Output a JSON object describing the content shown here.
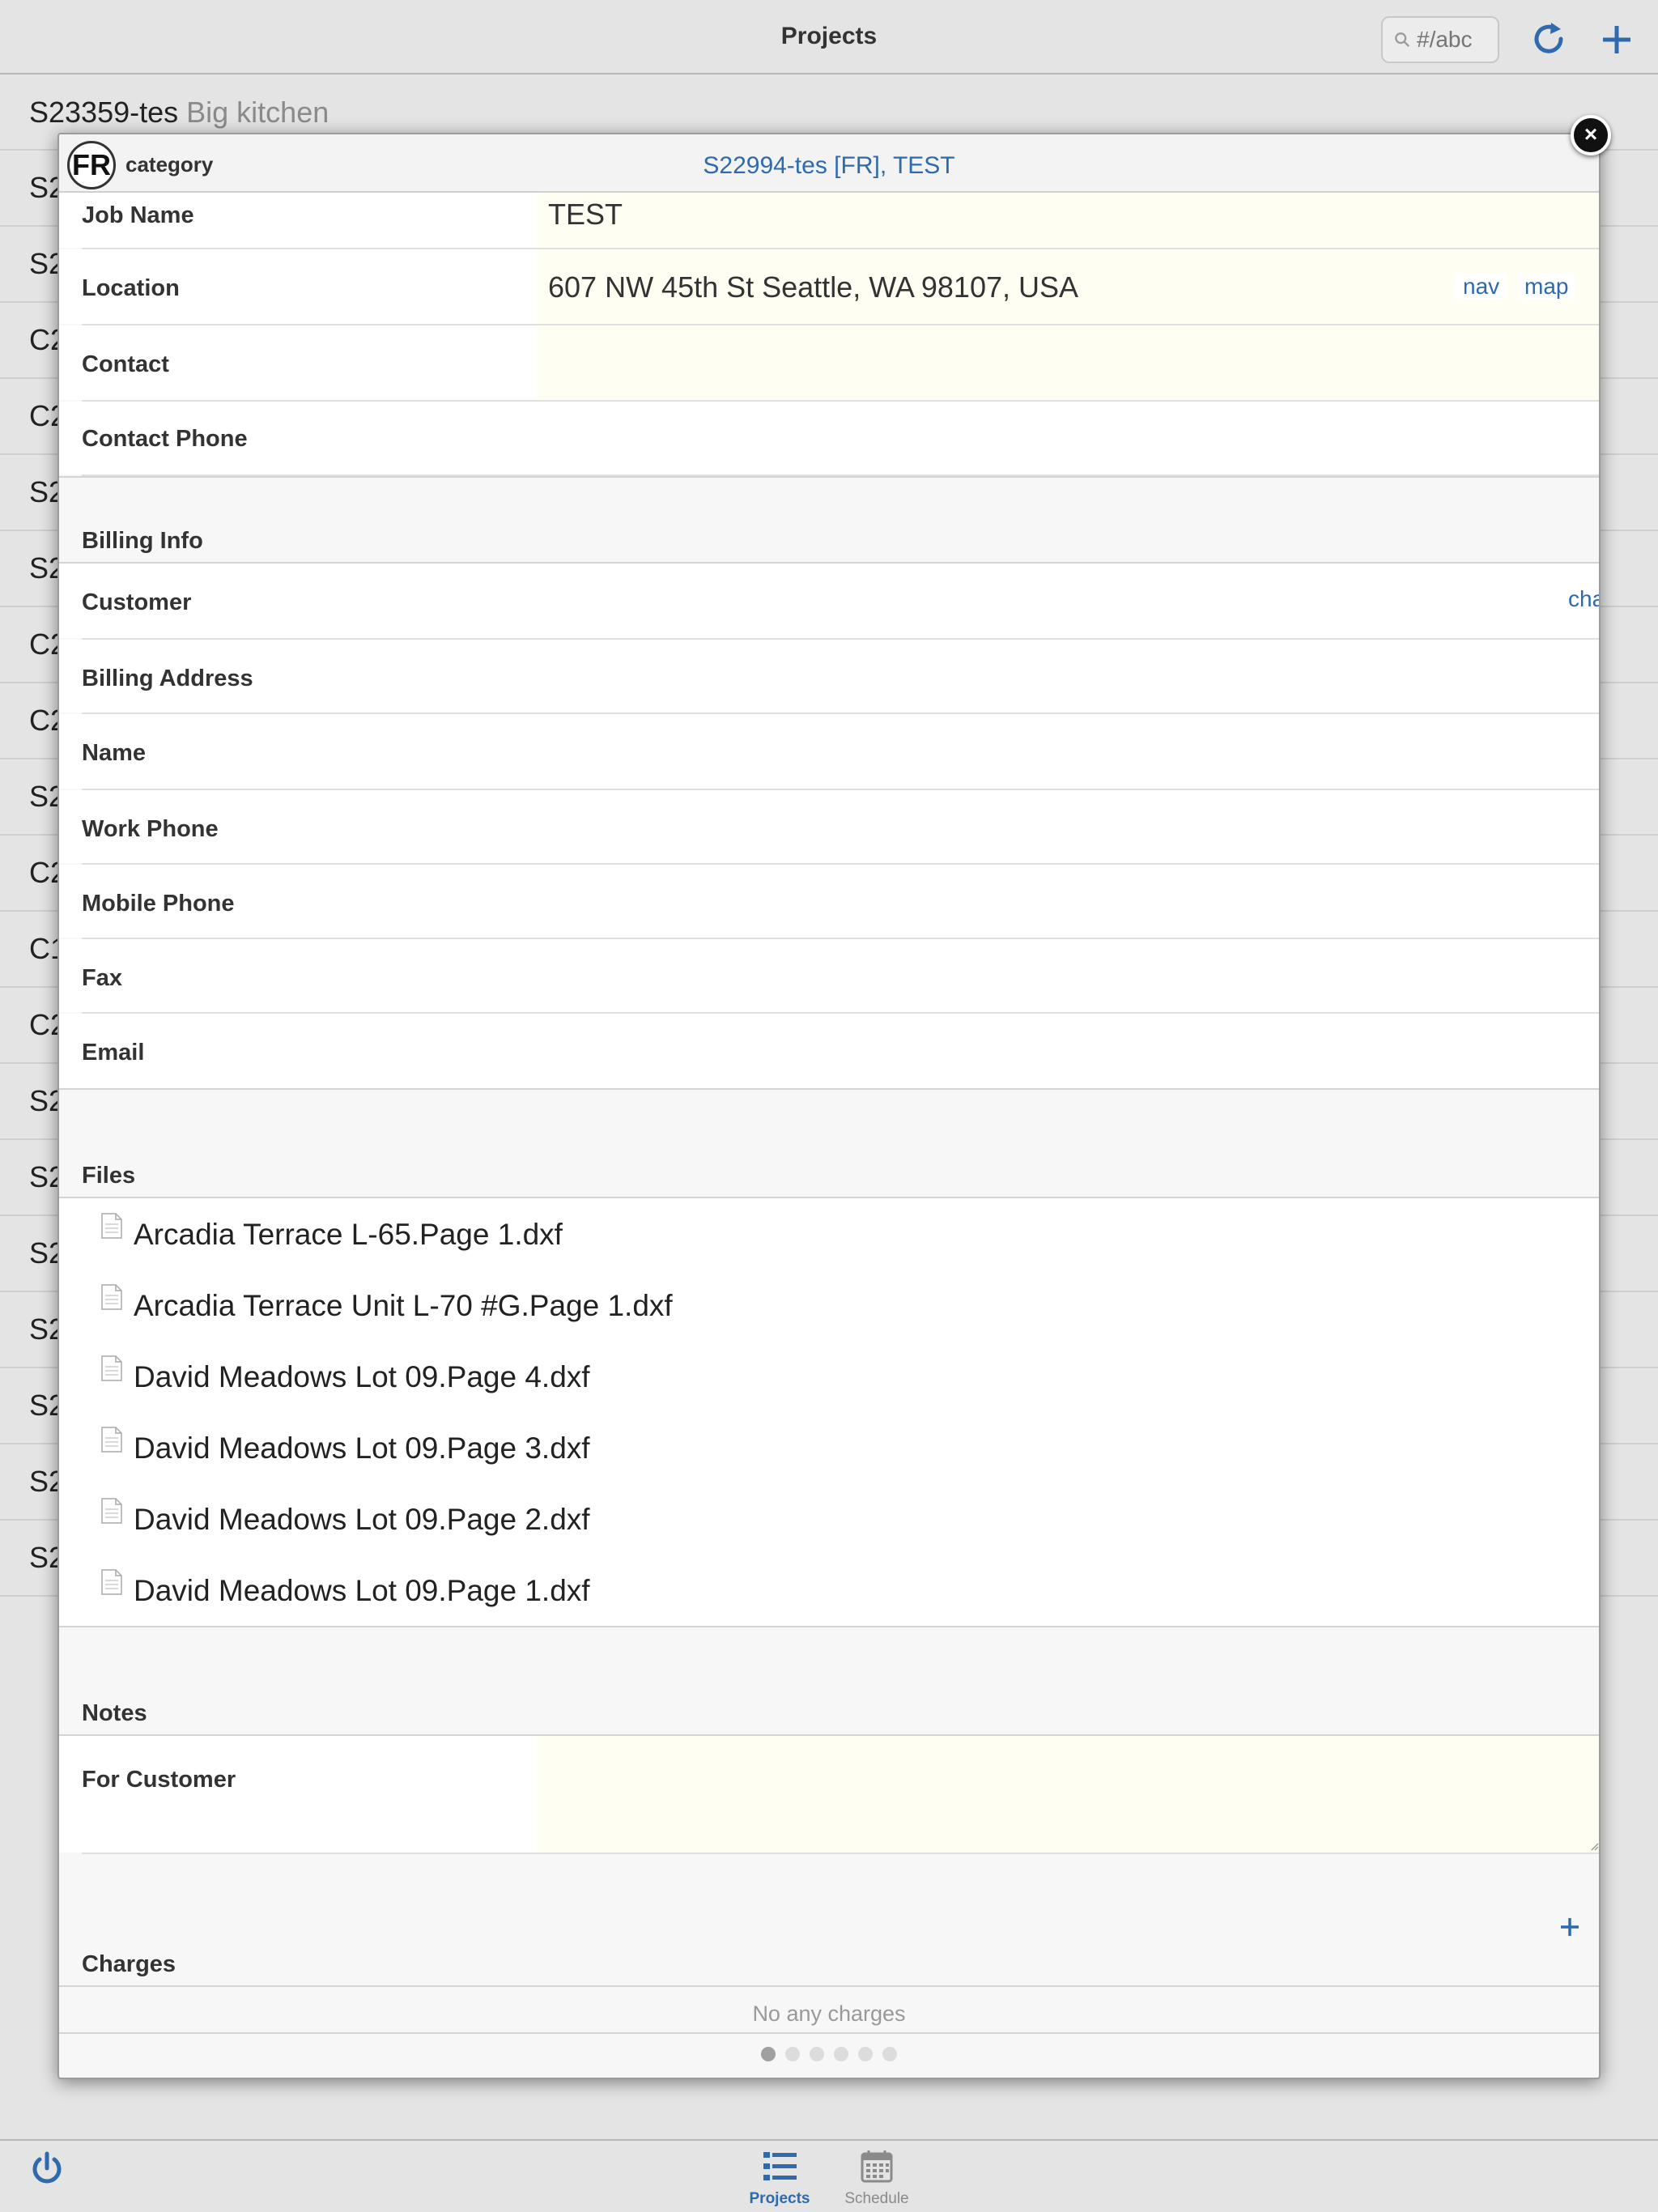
{
  "topbar": {
    "title": "Projects",
    "search_placeholder": "#/abc"
  },
  "background_list": [
    {
      "code": "S23359-tes",
      "desc": "Big kitchen"
    },
    {
      "code": "S2",
      "desc": ""
    },
    {
      "code": "S2",
      "desc": ""
    },
    {
      "code": "C2",
      "desc": ""
    },
    {
      "code": "C2",
      "desc": ""
    },
    {
      "code": "S2",
      "desc": ""
    },
    {
      "code": "S2",
      "desc": ""
    },
    {
      "code": "C2",
      "desc": ""
    },
    {
      "code": "C2",
      "desc": ""
    },
    {
      "code": "S2",
      "desc": ""
    },
    {
      "code": "C2",
      "desc": ""
    },
    {
      "code": "C1",
      "desc": ""
    },
    {
      "code": "C2",
      "desc": ""
    },
    {
      "code": "S2",
      "desc": ""
    },
    {
      "code": "S2",
      "desc": ""
    },
    {
      "code": "S2",
      "desc": ""
    },
    {
      "code": "S2",
      "desc": ""
    },
    {
      "code": "S2",
      "desc": ""
    },
    {
      "code": "S2",
      "desc": ""
    },
    {
      "code": "S2",
      "desc": ""
    }
  ],
  "modal": {
    "badge": "FR",
    "category_label": "category",
    "title": "S22994-tes [FR], TEST",
    "close_glyph": "×",
    "job_name_label": "Job Name",
    "job_name_value": "TEST",
    "location_label": "Location",
    "location_value": "607 NW 45th St Seattle, WA 98107, USA",
    "nav_link": "nav",
    "map_link": "map",
    "contact_label": "Contact",
    "contact_phone_label": "Contact Phone",
    "billing_header": "Billing Info",
    "customer_label": "Customer",
    "change_link": "change",
    "billing_address_label": "Billing Address",
    "name_label": "Name",
    "work_phone_label": "Work Phone",
    "mobile_phone_label": "Mobile Phone",
    "fax_label": "Fax",
    "email_label": "Email",
    "files_header": "Files",
    "files": [
      "Arcadia Terrace L-65.Page 1.dxf",
      "Arcadia Terrace Unit L-70 #G.Page 1.dxf",
      "David Meadows Lot 09.Page 4.dxf",
      "David Meadows Lot 09.Page 3.dxf",
      "David Meadows Lot 09.Page 2.dxf",
      "David Meadows Lot 09.Page 1.dxf"
    ],
    "notes_header": "Notes",
    "for_customer_label": "For Customer",
    "charges_header": "Charges",
    "add_charge_glyph": "+",
    "no_charges_text": "No any charges",
    "pager": {
      "count": 6,
      "active": 0
    }
  },
  "bottombar": {
    "tab_projects": "Projects",
    "tab_schedule": "Schedule"
  },
  "colors": {
    "accent": "#2e6aad",
    "input_bg": "#fffef3",
    "page_bg": "#e4e4e4"
  }
}
